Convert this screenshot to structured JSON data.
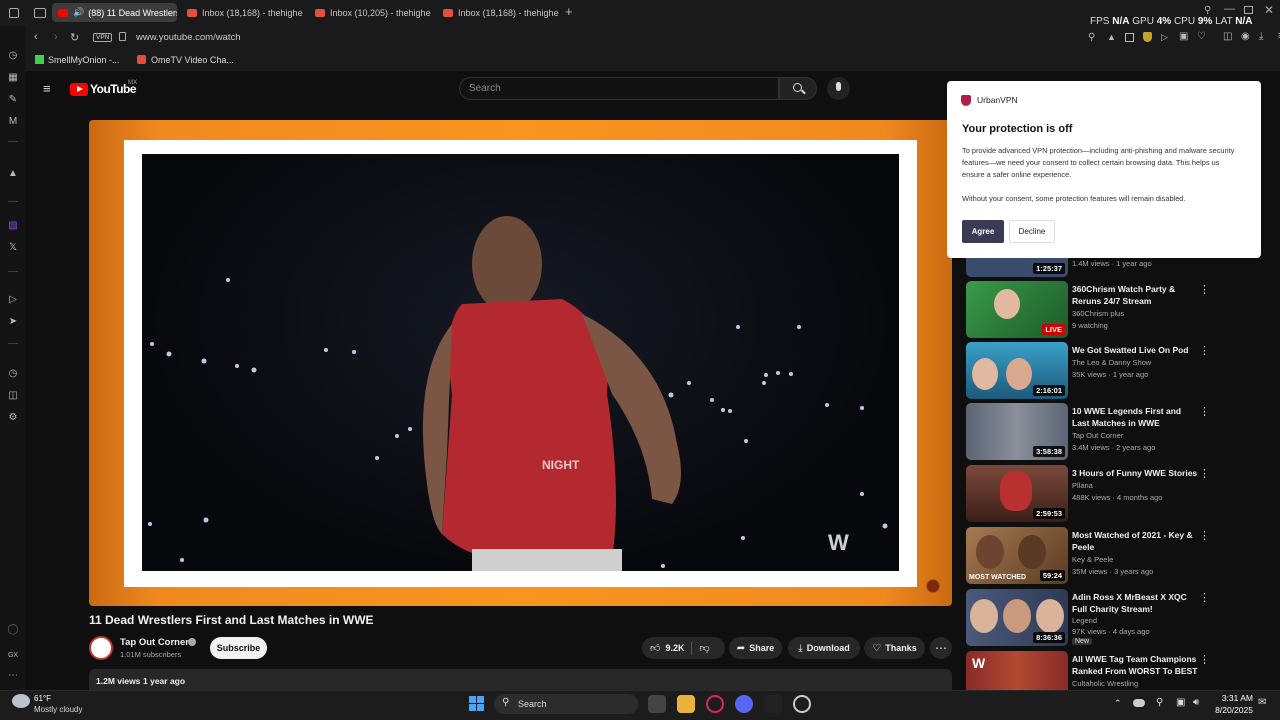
{
  "tabs": [
    {
      "label": "(88) 11 Dead Wrestlers",
      "active": true
    },
    {
      "label": "Inbox (18,168) - thehighe",
      "active": false
    },
    {
      "label": "Inbox (10,205) - thehighe",
      "active": false
    },
    {
      "label": "Inbox (18,168) - thehighe",
      "active": false
    }
  ],
  "address": {
    "vpn_badge": "VPN",
    "url": "www.youtube.com/watch"
  },
  "bookmarks": [
    {
      "label": "SmellMyOnion -..."
    },
    {
      "label": "OmeTV Video Cha..."
    }
  ],
  "hud": {
    "fps_label": "FPS",
    "fps_value": "N/A",
    "gpu_label": "GPU",
    "gpu_value": "4%",
    "cpu_label": "CPU",
    "cpu_value": "9%",
    "lat_label": "LAT",
    "lat_value": "N/A"
  },
  "youtube": {
    "logo_text": "YouTube",
    "region": "MX",
    "search_placeholder": "Search"
  },
  "video": {
    "title": "11 Dead Wrestlers First and Last Matches in WWE",
    "channel": "Tap Out Corner",
    "subscribers": "1.01M subscribers",
    "subscribe_label": "Subscribe",
    "likes": "9.2K",
    "share_label": "Share",
    "download_label": "Download",
    "thanks_label": "Thanks",
    "views": "1.2M views",
    "age": "1 year ago",
    "shirt_text": "NIGHT"
  },
  "vpn_popup": {
    "brand": "UrbanVPN",
    "title": "Your protection is off",
    "body": "To provide advanced VPN protection—including anti-phishing and malware security features—we need your consent to collect certain browsing data. This helps us ensure a safer online experience.",
    "note": "Without your consent, some protection features will remain disabled.",
    "agree_label": "Agree",
    "decline_label": "Decline"
  },
  "recommendations": [
    {
      "title": "",
      "channel": "",
      "meta": "1.4M views · 1 year ago",
      "duration": "1:25:37",
      "thumb_color": "#3a4b6b",
      "partial": true
    },
    {
      "title": "360Chrism Watch Party & Reruns 24/7 Stream",
      "channel": "360Chrism plus",
      "meta": "9 watching",
      "duration": "LIVE",
      "thumb_color": "#2f7d3a",
      "live": true
    },
    {
      "title": "We Got Swatted Live On Pod",
      "channel": "The Leo & Danny Show",
      "meta": "35K views · 1 year ago",
      "duration": "2:16:01",
      "thumb_color": "#2f6e8c"
    },
    {
      "title": "10 WWE Legends First and Last Matches in WWE",
      "channel": "Tap Out Corner",
      "meta": "3.4M views · 2 years ago",
      "duration": "3:58:38",
      "thumb_color": "#5b6475"
    },
    {
      "title": "3 Hours of Funny WWE Stories",
      "channel": "Pllana",
      "meta": "488K views · 4 months ago",
      "duration": "2:59:53",
      "thumb_color": "#6b3b3b"
    },
    {
      "title": "Most Watched of 2021 - Key & Peele",
      "channel": "Key & Peele",
      "meta": "35M views · 3 years ago",
      "duration": "59:24",
      "thumb_color": "#8a6a4a",
      "thumb_text": "MOST WATCHED"
    },
    {
      "title": "Adin Ross X MrBeast X XQC Full Charity Stream!",
      "channel": "Legend",
      "meta": "97K views · 4 days ago",
      "duration": "8:36:36",
      "thumb_color": "#4a5a7a",
      "badge": "New"
    },
    {
      "title": "All WWE Tag Team Champions Ranked From WORST To BEST",
      "channel": "Cultaholic Wrestling",
      "meta": "",
      "duration": "",
      "thumb_color": "#7a2a2a",
      "partial": true
    }
  ],
  "taskbar": {
    "weather_temp": "61°F",
    "weather_desc": "Mostly cloudy",
    "search_label": "Search",
    "time": "3:31 AM",
    "date": "8/20/2025"
  }
}
